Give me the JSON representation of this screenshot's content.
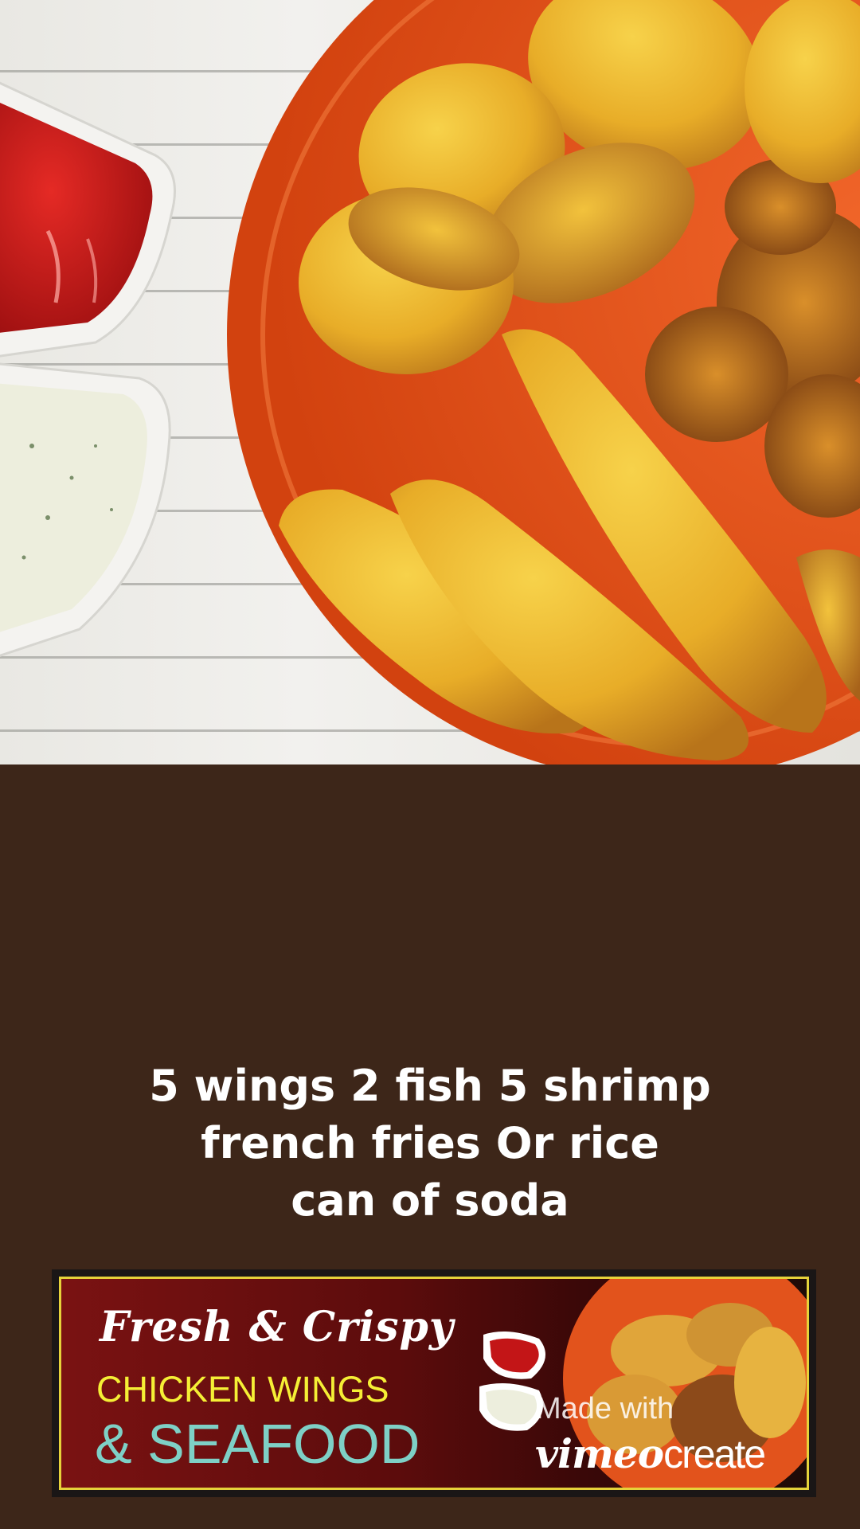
{
  "caption": {
    "line1": "5 wings 2 fish 5 shrimp",
    "line2": "french fries Or rice",
    "line3": "can of soda"
  },
  "banner": {
    "line1": "Fresh & Crispy",
    "line2": "CHICKEN WINGS",
    "line3": "& SEAFOOD"
  },
  "watermark": {
    "made_with": "Made with",
    "brand": "vimeo",
    "brand_suffix": "create"
  },
  "colors": {
    "background": "#3d2619",
    "plate": "#e2531c",
    "ketchup": "#c31517",
    "ranch": "#edeedd",
    "banner_yellow": "#f5ef35",
    "banner_teal": "#7ed0c6"
  }
}
